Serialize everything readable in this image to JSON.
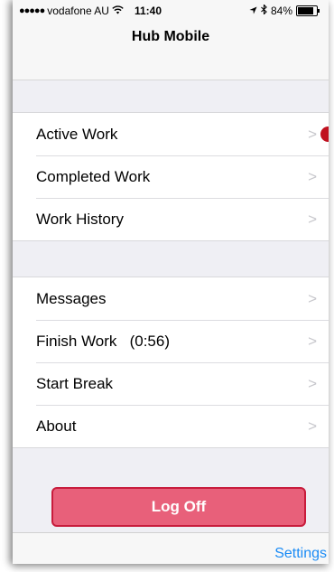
{
  "status_bar": {
    "carrier": "vodafone AU",
    "time": "11:40",
    "battery_percent": "84%",
    "battery_level": 0.84,
    "icons": [
      "signal-dots-icon",
      "wifi-icon",
      "location-arrow-icon",
      "bluetooth-icon",
      "battery-icon"
    ]
  },
  "nav": {
    "title": "Hub Mobile"
  },
  "group1": {
    "items": [
      {
        "label": "Active Work"
      },
      {
        "label": "Completed Work"
      },
      {
        "label": "Work History"
      }
    ]
  },
  "group2": {
    "items": [
      {
        "label": "Messages"
      },
      {
        "label": "Finish Work   (0:56)"
      },
      {
        "label": "Start Break"
      },
      {
        "label": "About"
      }
    ]
  },
  "chevron_glyph": ">",
  "logoff": {
    "label": "Log Off"
  },
  "toolbar": {
    "settings_label": "Settings"
  },
  "colors": {
    "background": "#efeff4",
    "logoff_fill": "#e8607a",
    "logoff_border": "#c81c3c",
    "link_blue": "#1a8bf5",
    "notification_dot": "#c0111f"
  }
}
